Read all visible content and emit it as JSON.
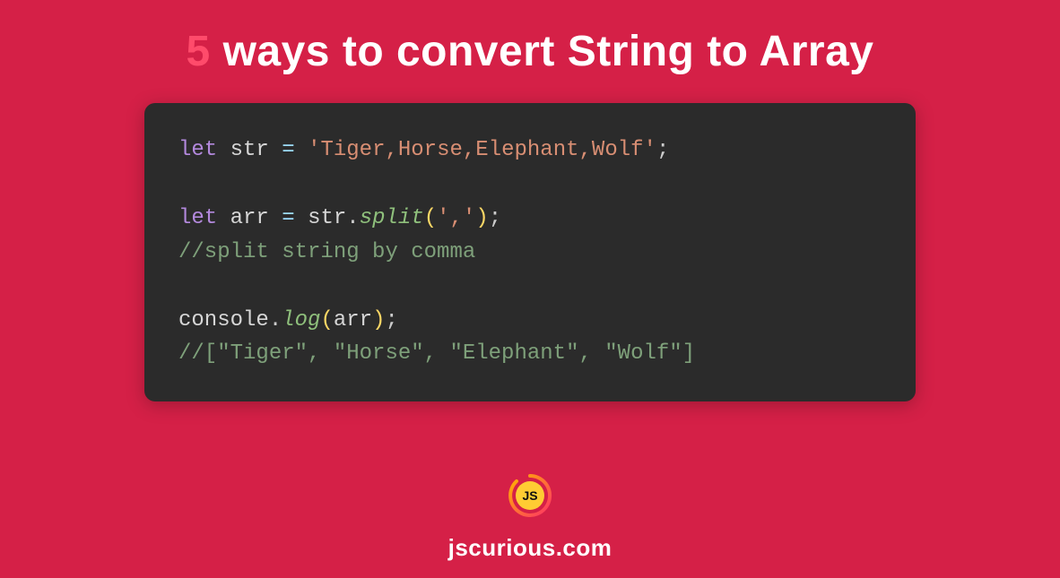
{
  "title": {
    "prefix_number": "5",
    "rest": " ways to convert String to Array"
  },
  "code": {
    "line1": {
      "keyword": "let",
      "variable": "str",
      "equals": "=",
      "string": "'Tiger,Horse,Elephant,Wolf'",
      "semicolon": ";"
    },
    "line2_blank": "",
    "line3": {
      "keyword": "let",
      "variable": "arr",
      "equals": "=",
      "obj": "str",
      "dot": ".",
      "method": "split",
      "open_paren": "(",
      "arg": "','",
      "close_paren": ")",
      "semicolon": ";"
    },
    "line4_comment": "//split string by comma",
    "line5_blank": "",
    "line6": {
      "obj": "console",
      "dot": ".",
      "method": "log",
      "open_paren": "(",
      "arg": "arr",
      "close_paren": ")",
      "semicolon": ";"
    },
    "line7_comment": "//[\"Tiger\", \"Horse\", \"Elephant\", \"Wolf\"]"
  },
  "footer": {
    "logo_text": "JS",
    "site": "jscurious.com"
  }
}
